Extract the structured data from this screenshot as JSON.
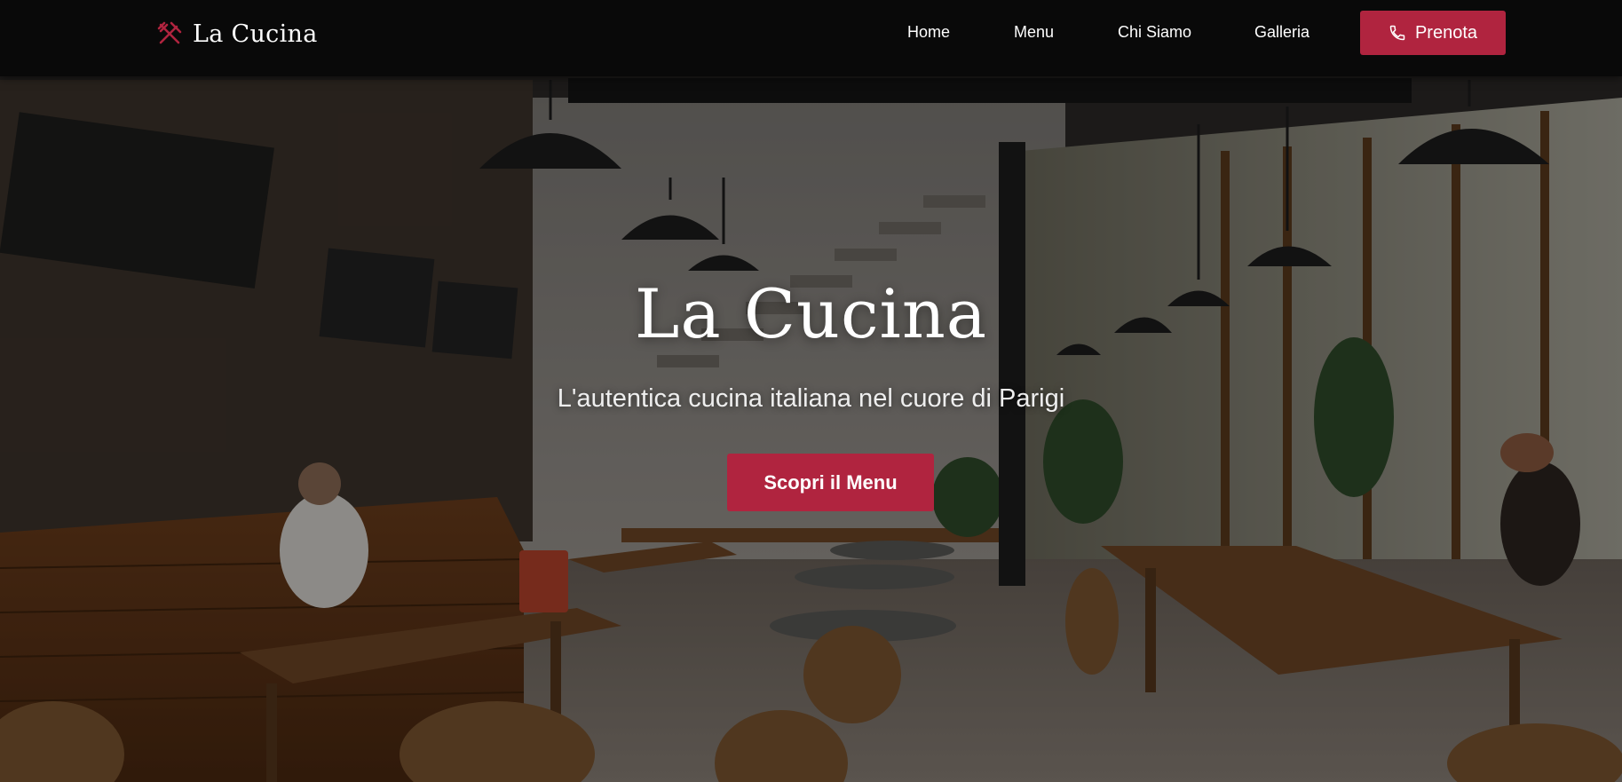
{
  "brand": {
    "name": "La Cucina",
    "icon": "utensils-crossed-icon"
  },
  "nav": {
    "items": [
      {
        "label": "Home"
      },
      {
        "label": "Menu"
      },
      {
        "label": "Chi Siamo"
      },
      {
        "label": "Galleria"
      }
    ],
    "cta": {
      "label": "Prenota",
      "icon": "phone-icon"
    }
  },
  "hero": {
    "title": "La Cucina",
    "subtitle": "L'autentica cucina italiana nel cuore di Parigi",
    "cta_label": "Scopri il Menu"
  },
  "colors": {
    "accent": "#b0243f",
    "navbar": "#080808",
    "text": "#ffffff"
  }
}
